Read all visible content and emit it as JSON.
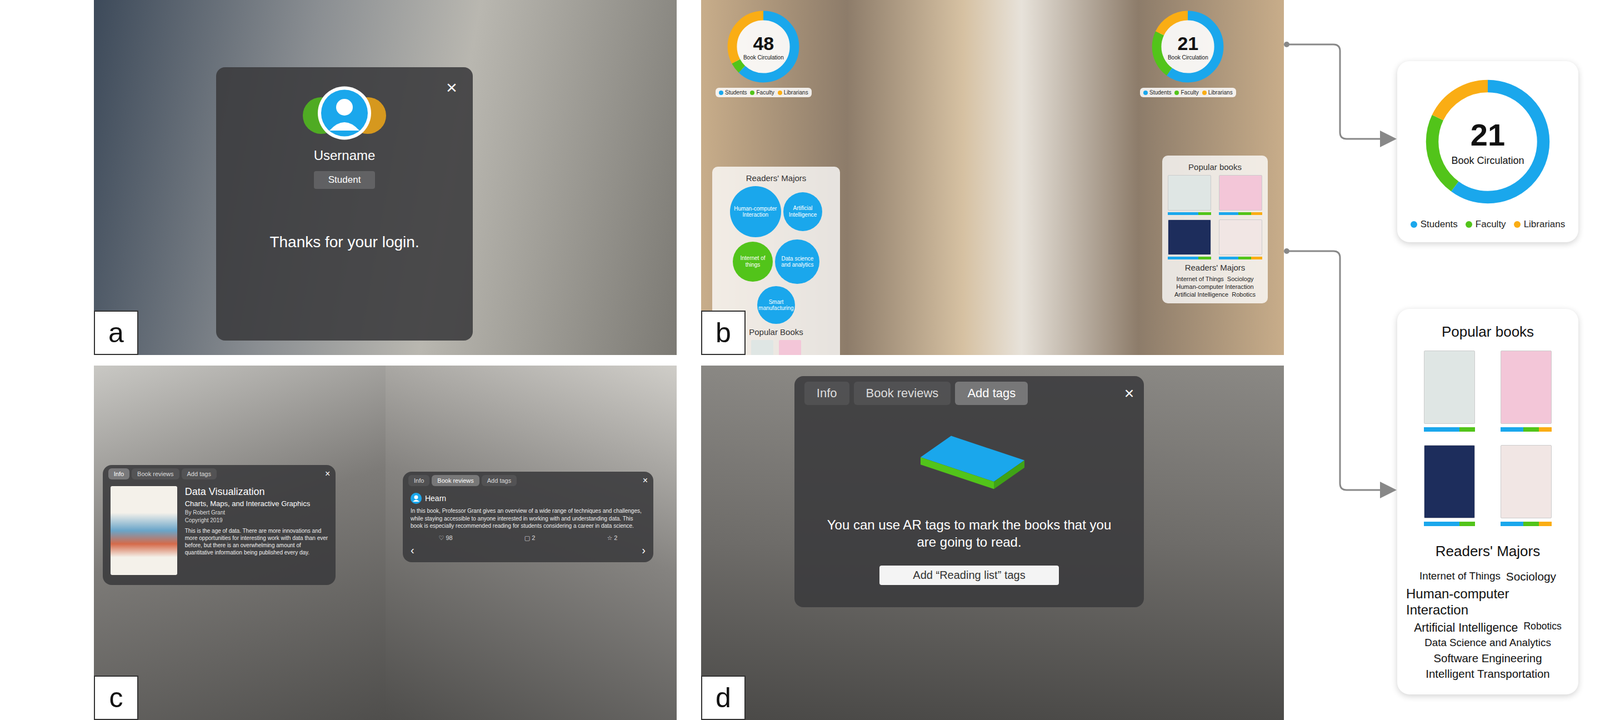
{
  "legend": [
    {
      "name": "Students",
      "color": "#1aa7ec"
    },
    {
      "name": "Faculty",
      "color": "#52c41a"
    },
    {
      "name": "Librarians",
      "color": "#faad14"
    }
  ],
  "login": {
    "label": "a",
    "close": "×",
    "username": "Username",
    "role": "Student",
    "message": "Thanks for your login."
  },
  "dashboard": {
    "label": "b",
    "donuts": [
      {
        "value": "48",
        "caption": "Book Circulation",
        "shares": [
          0.62,
          0.05,
          0.33
        ]
      },
      {
        "value": "21",
        "caption": "Book Circulation",
        "shares": [
          0.6,
          0.22,
          0.18
        ]
      }
    ],
    "majors_title": "Readers' Majors",
    "bubbles": [
      {
        "name": "Human-computer Interaction",
        "level": 1
      },
      {
        "name": "Artificial Intelligence",
        "level": 0.55
      },
      {
        "name": "Internet of things",
        "level": 0.6
      },
      {
        "name": "Data science and analytics",
        "level": 0.75
      },
      {
        "name": "Smart manufacturing",
        "level": 0.5
      }
    ],
    "popular_title": "Popular Books",
    "right_popular_title": "Popular books",
    "right_majors_title": "Readers' Majors",
    "right_majors": [
      "Internet of Things",
      "Sociology",
      "Human-computer Interaction",
      "Artificial Intelligence",
      "Robotics"
    ]
  },
  "book_info": {
    "label": "c",
    "tabs": [
      {
        "label": "Info",
        "selected": true
      },
      {
        "label": "Book reviews",
        "selected": false
      },
      {
        "label": "Add tags",
        "selected": false
      }
    ],
    "review_tabs": [
      {
        "label": "Info",
        "selected": false
      },
      {
        "label": "Book reviews",
        "selected": true
      },
      {
        "label": "Add tags",
        "selected": false
      }
    ],
    "close": "×",
    "title": "Data Visualization",
    "subtitle": "Charts, Maps, and Interactive Graphics",
    "author": "By Robert Grant",
    "copyright": "Copyright 2019",
    "description": "This is the age of data. There are more innovations and more opportunities for interesting work with data than ever before, but there is an overwhelming amount of quantitative information being published every day.",
    "reviewer": "Hearn",
    "review": "In this book, Professor Grant gives an overview of a wide range of techniques and challenges, while staying accessible to anyone interested in working with and understanding data. This book is especially recommended reading for students considering a career in data science.",
    "counts": [
      {
        "icon": "♡",
        "count": "98"
      },
      {
        "icon": "▢",
        "count": "2"
      },
      {
        "icon": "☆",
        "count": "2"
      }
    ],
    "prev": "‹",
    "next": "›"
  },
  "tagging": {
    "label": "d",
    "tabs": [
      {
        "label": "Info",
        "selected": false
      },
      {
        "label": "Book reviews",
        "selected": false
      },
      {
        "label": "Add tags",
        "selected": true
      }
    ],
    "close": "×",
    "message": "You can use AR tags to mark the books that you are going to read.",
    "button": "Add “Reading list” tags"
  },
  "summary": {
    "donut": {
      "value": "21",
      "caption": "Book Circulation",
      "shares": [
        0.6,
        0.22,
        0.18
      ]
    },
    "popular_title": "Popular books",
    "books": [
      {
        "color": "#dfe6e4",
        "shares": [
          0.7,
          0.3,
          0
        ]
      },
      {
        "color": "#f3c6d8",
        "shares": [
          0.45,
          0.3,
          0.25
        ]
      },
      {
        "color": "#1d2d5c",
        "shares": [
          0.7,
          0.3,
          0
        ]
      },
      {
        "color": "#f1e6e4",
        "shares": [
          0.45,
          0.3,
          0.25
        ]
      }
    ],
    "majors_title": "Readers' Majors",
    "majors": [
      {
        "name": "Internet of Things",
        "level": 0.35
      },
      {
        "name": "Sociology",
        "level": 0.6
      },
      {
        "name": "Human-computer Interaction",
        "level": 1
      },
      {
        "name": "Artificial Intelligence",
        "level": 0.65
      },
      {
        "name": "Robotics",
        "level": 0.2
      },
      {
        "name": "Data Science and Analytics",
        "level": 0.35
      },
      {
        "name": "Software Engineering",
        "level": 0.55
      },
      {
        "name": "Intelligent Transportation",
        "level": 0.55
      }
    ]
  }
}
